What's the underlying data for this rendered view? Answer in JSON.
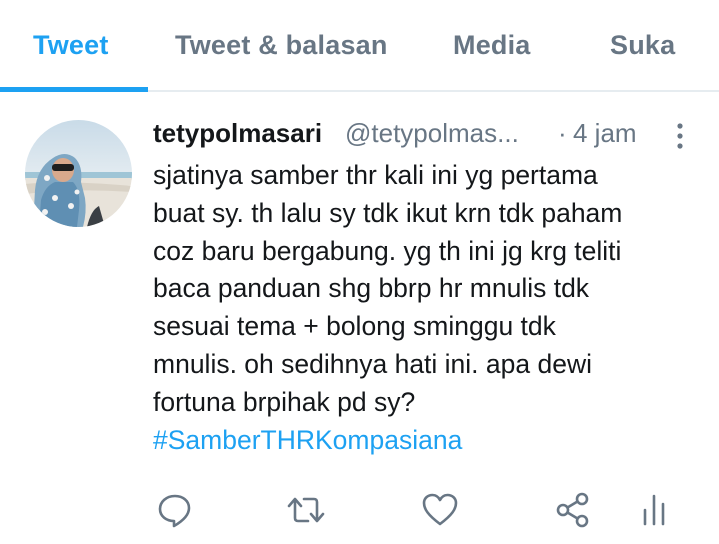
{
  "tabs": [
    {
      "label": "Tweet",
      "active": true
    },
    {
      "label": "Tweet & balasan",
      "active": false
    },
    {
      "label": "Media",
      "active": false
    },
    {
      "label": "Suka",
      "active": false
    }
  ],
  "tweet": {
    "display_name": "tetypolmasari",
    "handle": "@tetypolmas...",
    "separator": "·",
    "time": "4 jam",
    "lines": [
      "sjatinya samber thr kali ini yg pertama",
      "buat sy. th lalu sy tdk ikut krn tdk paham",
      "coz baru bergabung. yg th ini jg krg teliti",
      "baca panduan shg bbrp hr mnulis tdk",
      "sesuai tema + bolong sminggu tdk",
      "mnulis. oh sedihnya hati ini. apa dewi",
      "fortuna brpihak pd sy?"
    ],
    "hashtag": "#SamberTHRKompasiana"
  },
  "actions": [
    {
      "icon": "reply-icon"
    },
    {
      "icon": "retweet-icon"
    },
    {
      "icon": "like-icon"
    },
    {
      "icon": "share-icon"
    },
    {
      "icon": "analytics-icon"
    }
  ],
  "colors": {
    "accent": "#1da1f2",
    "text": "#14171a",
    "muted": "#687684",
    "divider": "#e6ecf0"
  }
}
